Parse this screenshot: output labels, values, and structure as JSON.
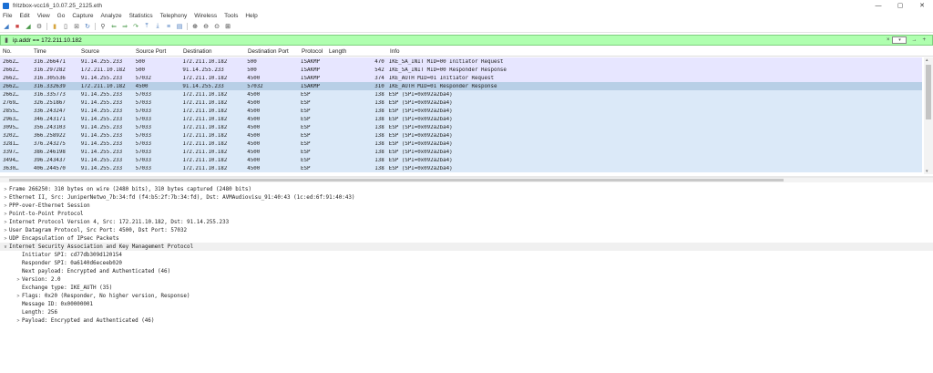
{
  "window": {
    "title": "fritzbox-vcc16_10.07.25_2125.eth",
    "controls": [
      "—",
      "▢",
      "✕"
    ]
  },
  "menu": [
    "File",
    "Edit",
    "View",
    "Go",
    "Capture",
    "Analyze",
    "Statistics",
    "Telephony",
    "Wireless",
    "Tools",
    "Help"
  ],
  "filter": {
    "value": "ip.addr == 172.211.10.182",
    "clear": "×",
    "apply": "→",
    "plus": "+"
  },
  "packet_list": {
    "columns": [
      "No.",
      "Time",
      "Source",
      "Source Port",
      "Destination",
      "Destination Port",
      "Protocol",
      "Length",
      "Info"
    ],
    "rows": [
      {
        "no": "2662…",
        "time": "316.266471",
        "src": "91.14.255.233",
        "sport": "500",
        "dst": "172.211.10.182",
        "dport": "500",
        "proto": "ISAKMP",
        "len": "470",
        "info": "IKE_SA_INIT MID=00 Initiator Request",
        "kind": "isakmp"
      },
      {
        "no": "2662…",
        "time": "316.297282",
        "src": "172.211.10.182",
        "sport": "500",
        "dst": "91.14.255.233",
        "dport": "500",
        "proto": "ISAKMP",
        "len": "542",
        "info": "IKE_SA_INIT MID=00 Responder Response",
        "kind": "isakmp"
      },
      {
        "no": "2662…",
        "time": "316.305536",
        "src": "91.14.255.233",
        "sport": "57032",
        "dst": "172.211.10.182",
        "dport": "4500",
        "proto": "ISAKMP",
        "len": "374",
        "info": "IKE_AUTH MID=01 Initiator Request",
        "kind": "isakmp"
      },
      {
        "no": "2662…",
        "time": "316.332639",
        "src": "172.211.10.182",
        "sport": "4500",
        "dst": "91.14.255.233",
        "dport": "57032",
        "proto": "ISAKMP",
        "len": "310",
        "info": "IKE_AUTH MID=01 Responder Response",
        "kind": "sel"
      },
      {
        "no": "2662…",
        "time": "316.335773",
        "src": "91.14.255.233",
        "sport": "57033",
        "dst": "172.211.10.182",
        "dport": "4500",
        "proto": "ESP",
        "len": "138",
        "info": "ESP (SPI=0x092a2ba4)",
        "kind": "esp"
      },
      {
        "no": "2769…",
        "time": "326.251867",
        "src": "91.14.255.233",
        "sport": "57033",
        "dst": "172.211.10.182",
        "dport": "4500",
        "proto": "ESP",
        "len": "138",
        "info": "ESP (SPI=0x092a2ba4)",
        "kind": "esp"
      },
      {
        "no": "2855…",
        "time": "336.243247",
        "src": "91.14.255.233",
        "sport": "57033",
        "dst": "172.211.10.182",
        "dport": "4500",
        "proto": "ESP",
        "len": "138",
        "info": "ESP (SPI=0x092a2ba4)",
        "kind": "esp"
      },
      {
        "no": "2963…",
        "time": "346.243171",
        "src": "91.14.255.233",
        "sport": "57033",
        "dst": "172.211.10.182",
        "dport": "4500",
        "proto": "ESP",
        "len": "138",
        "info": "ESP (SPI=0x092a2ba4)",
        "kind": "esp"
      },
      {
        "no": "3095…",
        "time": "356.243103",
        "src": "91.14.255.233",
        "sport": "57033",
        "dst": "172.211.10.182",
        "dport": "4500",
        "proto": "ESP",
        "len": "138",
        "info": "ESP (SPI=0x092a2ba4)",
        "kind": "esp"
      },
      {
        "no": "3202…",
        "time": "366.258922",
        "src": "91.14.255.233",
        "sport": "57033",
        "dst": "172.211.10.182",
        "dport": "4500",
        "proto": "ESP",
        "len": "138",
        "info": "ESP (SPI=0x092a2ba4)",
        "kind": "esp"
      },
      {
        "no": "3281…",
        "time": "376.243275",
        "src": "91.14.255.233",
        "sport": "57033",
        "dst": "172.211.10.182",
        "dport": "4500",
        "proto": "ESP",
        "len": "138",
        "info": "ESP (SPI=0x092a2ba4)",
        "kind": "esp"
      },
      {
        "no": "3397…",
        "time": "386.246198",
        "src": "91.14.255.233",
        "sport": "57033",
        "dst": "172.211.10.182",
        "dport": "4500",
        "proto": "ESP",
        "len": "138",
        "info": "ESP (SPI=0x092a2ba4)",
        "kind": "esp"
      },
      {
        "no": "3494…",
        "time": "396.243437",
        "src": "91.14.255.233",
        "sport": "57033",
        "dst": "172.211.10.182",
        "dport": "4500",
        "proto": "ESP",
        "len": "138",
        "info": "ESP (SPI=0x092a2ba4)",
        "kind": "esp"
      },
      {
        "no": "3630…",
        "time": "406.244570",
        "src": "91.14.255.233",
        "sport": "57033",
        "dst": "172.211.10.182",
        "dport": "4500",
        "proto": "ESP",
        "len": "138",
        "info": "ESP (SPI=0x092a2ba4)",
        "kind": "esp"
      }
    ]
  },
  "details": [
    {
      "indent": 0,
      "arrow": ">",
      "text": "Frame 266250: 310 bytes on wire (2480 bits), 310 bytes captured (2480 bits)"
    },
    {
      "indent": 0,
      "arrow": ">",
      "text": "Ethernet II, Src: JuniperNetwo_7b:34:fd (f4:b5:2f:7b:34:fd), Dst: AVMAudiovisu_91:40:43 (1c:ed:6f:91:40:43)"
    },
    {
      "indent": 0,
      "arrow": ">",
      "text": "PPP-over-Ethernet Session"
    },
    {
      "indent": 0,
      "arrow": ">",
      "text": "Point-to-Point Protocol"
    },
    {
      "indent": 0,
      "arrow": ">",
      "text": "Internet Protocol Version 4, Src: 172.211.10.182, Dst: 91.14.255.233"
    },
    {
      "indent": 0,
      "arrow": ">",
      "text": "User Datagram Protocol, Src Port: 4500, Dst Port: 57032"
    },
    {
      "indent": 0,
      "arrow": ">",
      "text": "UDP Encapsulation of IPsec Packets"
    },
    {
      "indent": 0,
      "arrow": "v",
      "text": "Internet Security Association and Key Management Protocol"
    },
    {
      "indent": 1,
      "arrow": "",
      "text": "Initiator SPI: cd77db309d120154"
    },
    {
      "indent": 1,
      "arrow": "",
      "text": "Responder SPI: 0a6140d6eceeb020"
    },
    {
      "indent": 1,
      "arrow": "",
      "text": "Next payload: Encrypted and Authenticated (46)"
    },
    {
      "indent": 1,
      "arrow": ">",
      "text": "Version: 2.0"
    },
    {
      "indent": 1,
      "arrow": "",
      "text": "Exchange type: IKE_AUTH (35)"
    },
    {
      "indent": 1,
      "arrow": ">",
      "text": "Flags: 0x20 (Responder, No higher version, Response)"
    },
    {
      "indent": 1,
      "arrow": "",
      "text": "Message ID: 0x00000001"
    },
    {
      "indent": 1,
      "arrow": "",
      "text": "Length: 256"
    },
    {
      "indent": 1,
      "arrow": ">",
      "text": "Payload: Encrypted and Authenticated (46)"
    }
  ]
}
